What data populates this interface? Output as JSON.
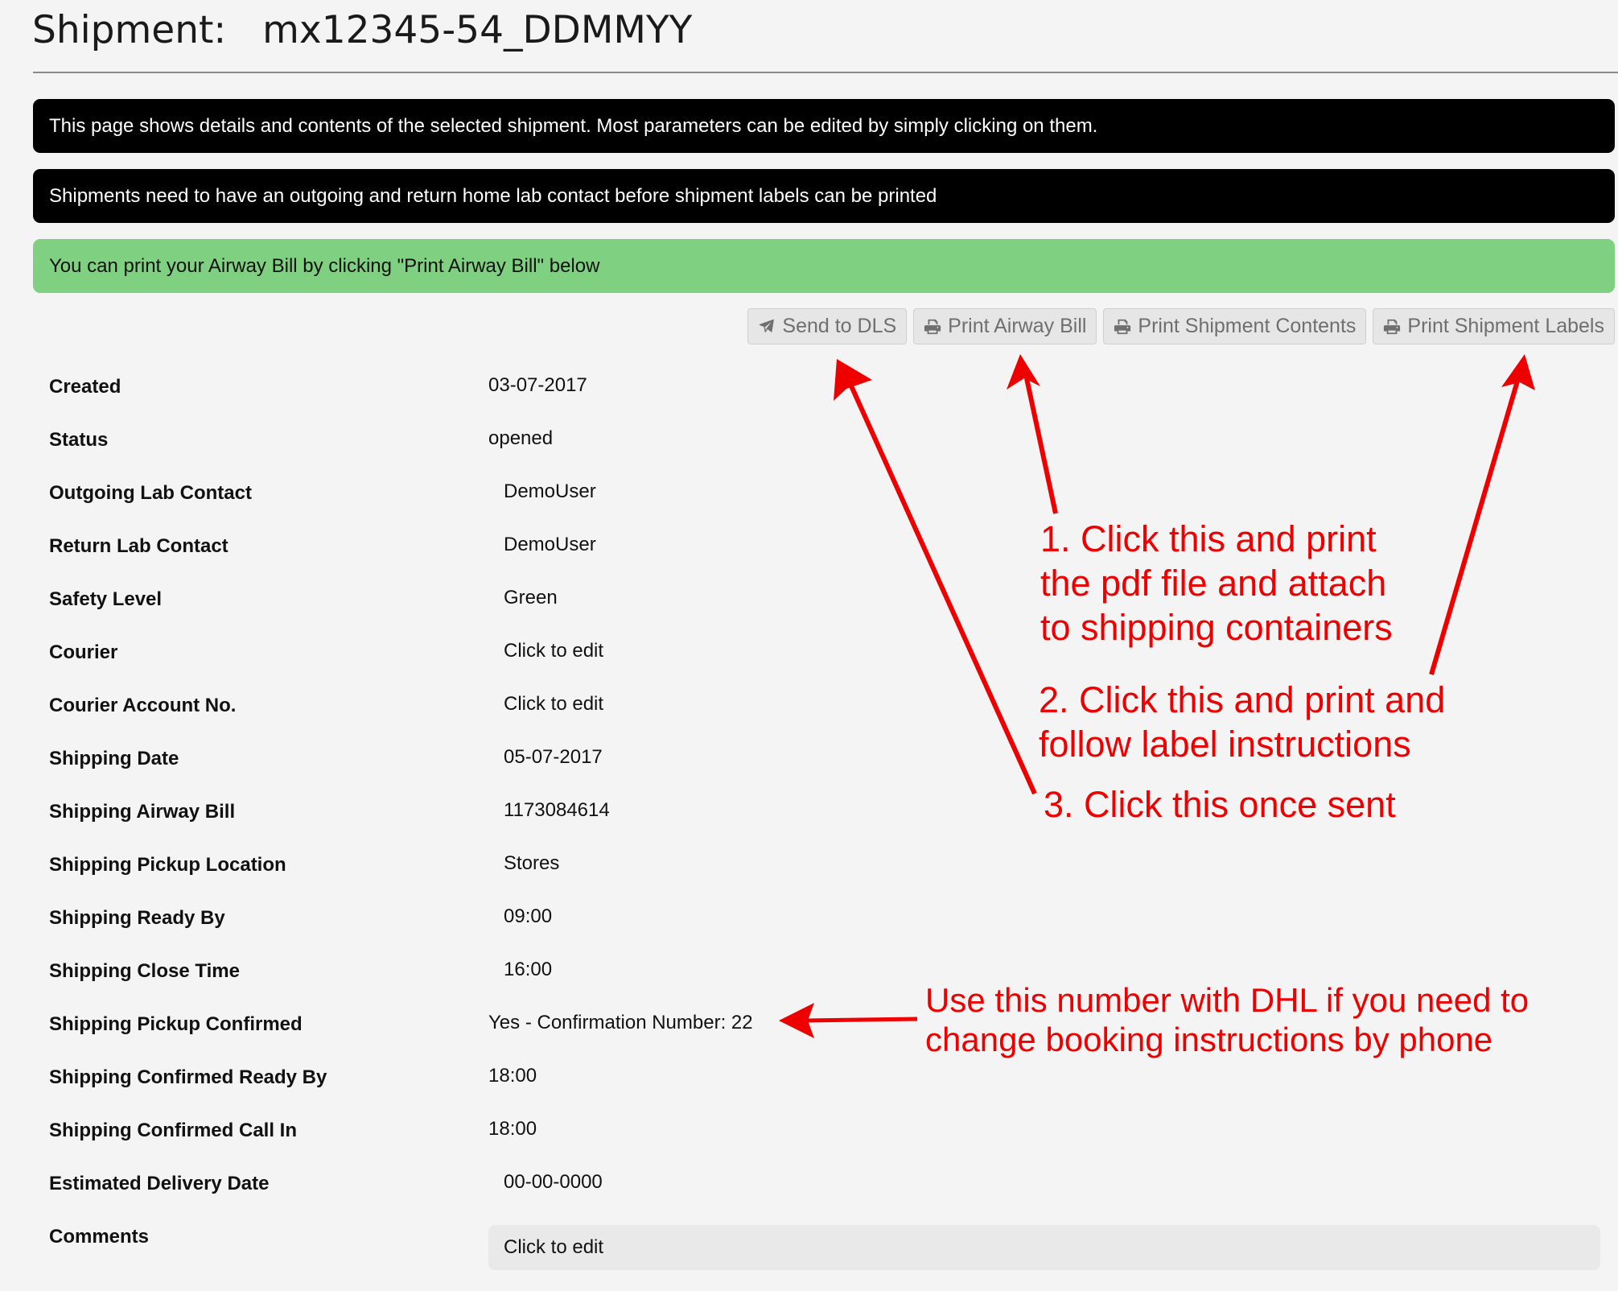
{
  "header": {
    "title_prefix": "Shipment:",
    "title_id": "mx12345-54_DDMMYY"
  },
  "banners": {
    "info": "This page shows details and contents of the selected shipment. Most parameters can be edited by simply clicking on them.",
    "contact_warning": "Shipments need to have an outgoing and return home lab contact before shipment labels can be printed",
    "success": "You can print your Airway Bill by clicking \"Print Airway Bill\" below"
  },
  "toolbar": {
    "send_label": "Send to DLS",
    "airway_label": "Print Airway Bill",
    "contents_label": "Print Shipment Contents",
    "labels_label": "Print Shipment Labels",
    "icons": [
      "plane-icon",
      "printer-icon",
      "printer-icon",
      "printer-icon"
    ]
  },
  "details": [
    {
      "label": "Created",
      "value": "03-07-2017"
    },
    {
      "label": "Status",
      "value": "opened"
    },
    {
      "label": "Outgoing Lab Contact",
      "value": "DemoUser"
    },
    {
      "label": "Return Lab Contact",
      "value": "DemoUser"
    },
    {
      "label": "Safety Level",
      "value": "Green"
    },
    {
      "label": "Courier",
      "value": "Click to edit"
    },
    {
      "label": "Courier Account No.",
      "value": "Click to edit"
    },
    {
      "label": "Shipping Date",
      "value": "05-07-2017"
    },
    {
      "label": "Shipping Airway Bill",
      "value": "1173084614"
    },
    {
      "label": "Shipping Pickup Location",
      "value": "Stores"
    },
    {
      "label": "Shipping Ready By",
      "value": "09:00"
    },
    {
      "label": "Shipping Close Time",
      "value": "16:00"
    },
    {
      "label": "Shipping Pickup Confirmed",
      "value": "Yes - Confirmation Number: 22"
    },
    {
      "label": "Shipping Confirmed Ready By",
      "value": "18:00"
    },
    {
      "label": "Shipping Confirmed Call In",
      "value": "18:00"
    },
    {
      "label": "Estimated Delivery Date",
      "value": "00-00-0000"
    },
    {
      "label": "Comments",
      "value": "Click to edit"
    }
  ],
  "annotations": {
    "step1": [
      "1. Click this and print",
      "the pdf file and attach",
      "to shipping containers"
    ],
    "step2": [
      "2. Click this and print and",
      "follow label instructions"
    ],
    "step3": "3. Click this once sent",
    "dhl_note": [
      "Use this number with DHL if you need to",
      "change booking instructions by phone"
    ],
    "color": "#ee0000"
  },
  "colors": {
    "background": "#f4f4f4",
    "banner_dark": "#000000",
    "banner_success": "#80d081",
    "button_bg": "#e6e6e6",
    "button_text": "#6f6f6f"
  }
}
